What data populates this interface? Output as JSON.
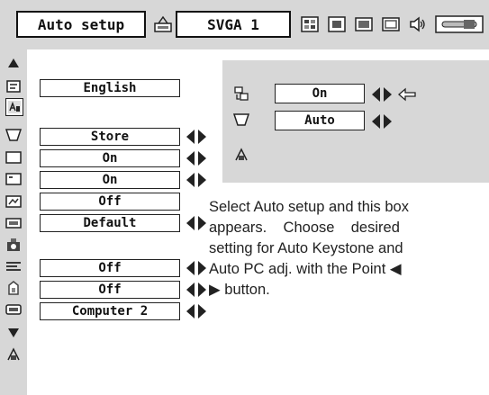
{
  "toolbar": {
    "title": "Auto setup",
    "mode": "SVGA 1",
    "icons": [
      "pc-adjust-icon",
      "image-select-icon",
      "image-adjust-icon",
      "screen-icon",
      "sound-icon",
      "setting-icon"
    ]
  },
  "menu": {
    "rows": [
      {
        "icon": "language-icon",
        "value": "English",
        "arrows": false
      },
      {
        "icon": "auto-setup-icon",
        "value": "",
        "arrows": false
      },
      {
        "icon": "keystone-icon",
        "value": "Store",
        "arrows": true
      },
      {
        "icon": "blue-back-icon",
        "value": "On",
        "arrows": true
      },
      {
        "icon": "display-icon",
        "value": "On",
        "arrows": true
      },
      {
        "icon": "logo-icon",
        "value": "Off",
        "arrows": false
      },
      {
        "icon": "ceiling-icon",
        "value": "Default",
        "arrows": true
      },
      {
        "icon": "rear-icon",
        "value": "",
        "arrows": false
      },
      {
        "icon": "power-management-icon",
        "value": "Off",
        "arrows": true
      },
      {
        "icon": "lamp-counter-icon",
        "value": "Off",
        "arrows": true
      },
      {
        "icon": "terminal-icon",
        "value": "Computer 2",
        "arrows": true
      }
    ]
  },
  "submenu": {
    "rows": [
      {
        "icon": "auto-pc-adj-icon",
        "value": "On",
        "arrows": true,
        "pointer": true
      },
      {
        "icon": "auto-keystone-icon",
        "value": "Auto",
        "arrows": true,
        "pointer": false
      },
      {
        "icon": "quit-icon",
        "value": "",
        "arrows": false,
        "pointer": false
      }
    ]
  },
  "description": {
    "lines": [
      "Select Auto setup and this box",
      "appears.    Choose    desired",
      "setting for Auto Keystone and",
      "Auto PC adj. with the Point ◀",
      "▶ button."
    ]
  }
}
